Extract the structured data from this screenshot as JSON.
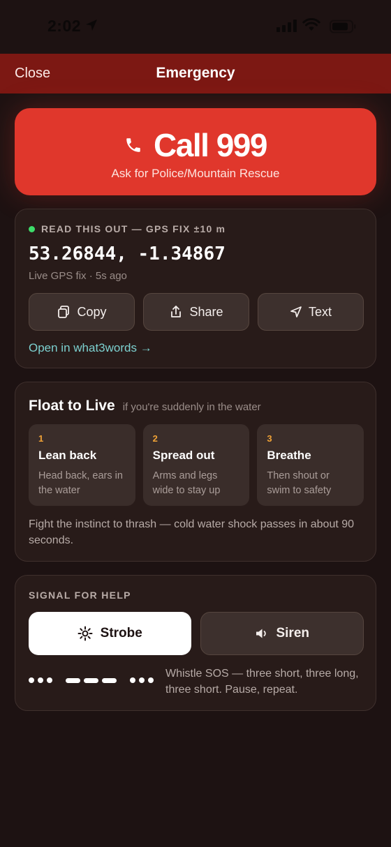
{
  "status_bar": {
    "time": "2:02"
  },
  "nav": {
    "close_label": "Close",
    "title": "Emergency"
  },
  "call": {
    "label": "Call 999",
    "subtitle": "Ask for Police/Mountain Rescue"
  },
  "gps": {
    "header": "READ THIS OUT — GPS FIX ±10 m",
    "coords": "53.26844, -1.34867",
    "status": "Live GPS fix · 5s ago",
    "buttons": {
      "copy": "Copy",
      "share": "Share",
      "text": "Text"
    },
    "w3w_link": "Open in what3words →",
    "indicator_color": "#3ddc6a"
  },
  "float": {
    "title": "Float to Live",
    "subtitle": "if you're suddenly in the water",
    "steps": [
      {
        "num": "1",
        "title": "Lean back",
        "desc": "Head back, ears in the water"
      },
      {
        "num": "2",
        "title": "Spread out",
        "desc": "Arms and legs wide to stay up"
      },
      {
        "num": "3",
        "title": "Breathe",
        "desc": "Then shout or swim to safety"
      }
    ],
    "note": "Fight the instinct to thrash — cold water shock passes in about 90 seconds."
  },
  "signal": {
    "title": "SIGNAL FOR HELP",
    "strobe_label": "Strobe",
    "siren_label": "Siren",
    "sos_note": "Whistle SOS — three short, three long, three short. Pause, repeat."
  },
  "colors": {
    "call_red": "#e0372c",
    "nav_bar": "#7c1813",
    "accent_teal": "#7cd0cf",
    "step_number": "#f0a236"
  }
}
